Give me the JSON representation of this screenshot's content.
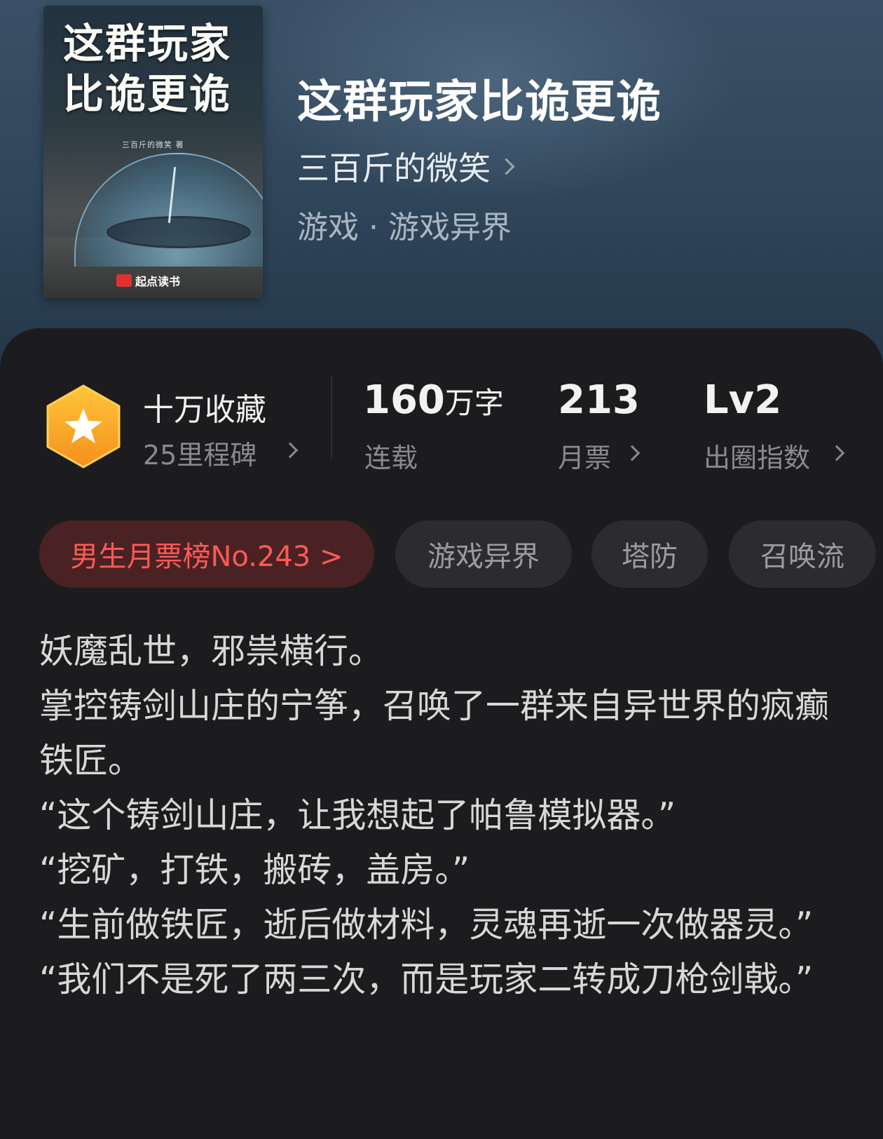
{
  "book": {
    "cover": {
      "title_line1": "这群玩家",
      "title_line2": "比诡更诡",
      "author_credit": "三百斤的微笑 著",
      "publisher": "起点读书"
    },
    "title": "这群玩家比诡更诡",
    "author": "三百斤的微笑",
    "genre": "游戏 · 游戏异界"
  },
  "stats": {
    "collection": {
      "label": "十万收藏",
      "sub": "25里程碑"
    },
    "words": {
      "number": "160",
      "unit": "万字",
      "sub": "连载"
    },
    "monthly_votes": {
      "number": "213",
      "sub": "月票"
    },
    "breakout": {
      "number": "Lv2",
      "sub": "出圈指数"
    }
  },
  "tags": {
    "rank": "男生月票榜No.243 >",
    "items": [
      "游戏异界",
      "塔防",
      "召唤流"
    ]
  },
  "synopsis": [
    "妖魔乱世，邪祟横行。",
    "掌控铸剑山庄的宁筝，召唤了一群来自异世界的疯癫铁匠。",
    "“这个铸剑山庄，让我想起了帕鲁模拟器。”",
    "“挖矿，打铁，搬砖，盖房。”",
    "“生前做铁匠，逝后做材料，灵魂再逝一次做器灵。”",
    "“我们不是死了两三次，而是玩家二转成刀枪剑戟。”"
  ],
  "colors": {
    "accent_red": "#ff5a55",
    "badge_orange": "#f6a524",
    "panel_bg": "#1c1c1e"
  }
}
